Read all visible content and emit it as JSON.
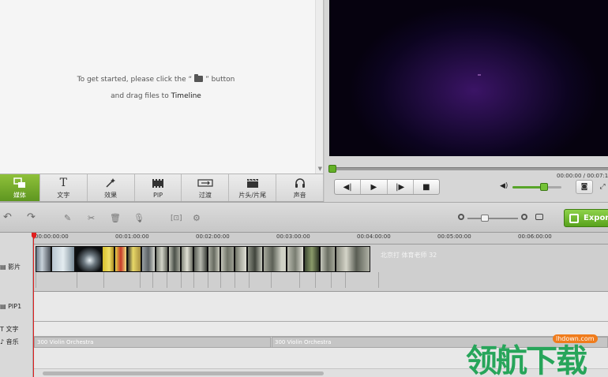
{
  "media_panel": {
    "hint_part1": "To get started, please click the “",
    "hint_part2": "” button",
    "hint_line2_prefix": "and drag files to ",
    "hint_line2_bold": "Timeline",
    "folder_icon": "folder-open-icon"
  },
  "tabs": [
    {
      "label": "媒体",
      "icon": "media-icon",
      "active": true
    },
    {
      "label": "文字",
      "icon": "text-icon"
    },
    {
      "label": "效果",
      "icon": "effects-wand-icon"
    },
    {
      "label": "PIP",
      "icon": "pip-film-icon"
    },
    {
      "label": "过渡",
      "icon": "transition-icon"
    },
    {
      "label": "片头/片尾",
      "icon": "clapper-icon"
    },
    {
      "label": "声音",
      "icon": "headphones-icon"
    }
  ],
  "preview": {
    "time_text": "00:00:00 / 00:07:1",
    "volume_level": 0.65
  },
  "toolbar": {
    "export_label": "Export",
    "icons": [
      "undo-icon",
      "redo-icon",
      "edit-icon",
      "cut-icon",
      "delete-icon",
      "record-voice-icon",
      "crop-icon",
      "settings-icon"
    ],
    "zoom_level": 0.35
  },
  "timeline": {
    "ruler_ticks": [
      "00:00:00:00",
      "00:01:00:00",
      "00:02:00:00",
      "00:03:00:00",
      "00:04:00:00",
      "00:05:00:00",
      "00:06:00:00"
    ],
    "track_video_label": "影片",
    "track_pip_label": "PIP1",
    "track_text_label": "文字",
    "track_music_label": "音乐",
    "clip_label": "北京打 体育老师 32",
    "music_clip_1": "300 Violin Orchestra",
    "music_clip_2": "300 Violin Orchestra"
  },
  "watermark": {
    "text": "领航下载",
    "badge": "lhdown.com"
  },
  "colors": {
    "accent_green": "#5e9620",
    "playhead_red": "#e02020",
    "watermark_green": "#27a55a"
  }
}
